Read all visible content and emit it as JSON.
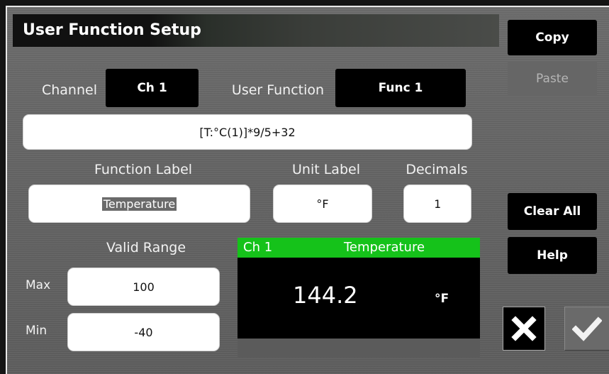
{
  "title": "User Function Setup",
  "channel": {
    "label": "Channel",
    "value": "Ch 1"
  },
  "user_function": {
    "label": "User Function",
    "value": "Func 1"
  },
  "formula": "[T:°C(1)]*9/5+32",
  "function_label": {
    "label": "Function Label",
    "value": "Temperature"
  },
  "unit_label": {
    "label": "Unit Label",
    "value": "°F"
  },
  "decimals": {
    "label": "Decimals",
    "value": "1"
  },
  "valid_range": {
    "label": "Valid Range",
    "max_label": "Max",
    "max_value": "100",
    "min_label": "Min",
    "min_value": "-40"
  },
  "preview": {
    "channel": "Ch 1",
    "name": "Temperature",
    "reading": "144.2",
    "unit": "°F"
  },
  "buttons": {
    "copy": "Copy",
    "paste": "Paste",
    "clear_all": "Clear All",
    "help": "Help"
  },
  "icons": {
    "cancel": "close-icon",
    "confirm": "check-icon"
  },
  "colors": {
    "accent_green": "#15c21a",
    "button_black": "#000000"
  }
}
